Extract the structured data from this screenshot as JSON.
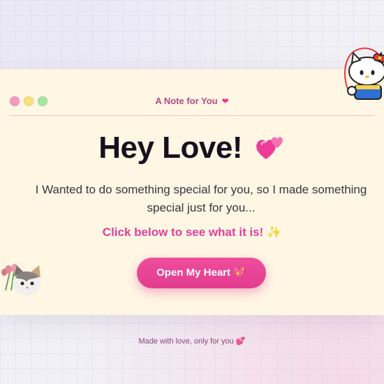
{
  "window": {
    "title": "A Note for You",
    "title_icon": "heart-icon",
    "controls": [
      "close",
      "minimize",
      "maximize"
    ]
  },
  "main": {
    "headline": "Hey Love!",
    "headline_icon": "two-hearts-icon",
    "message": "I Wanted to do something special for you, so I made something special just for you...",
    "cta_text": "Click below to see what it is!",
    "cta_icon": "sparkles-icon",
    "button_label": "Open My Heart 💖"
  },
  "footer": {
    "text": "Made with love, only for you 💕"
  },
  "decorations": {
    "top_right": "hello-kitty-sticker",
    "bottom_left": "cat-with-tulips-sticker"
  },
  "colors": {
    "accent": "#e8348f",
    "card": "#fff6e4",
    "title": "#b24a86",
    "headline": "#1a0f1e"
  }
}
